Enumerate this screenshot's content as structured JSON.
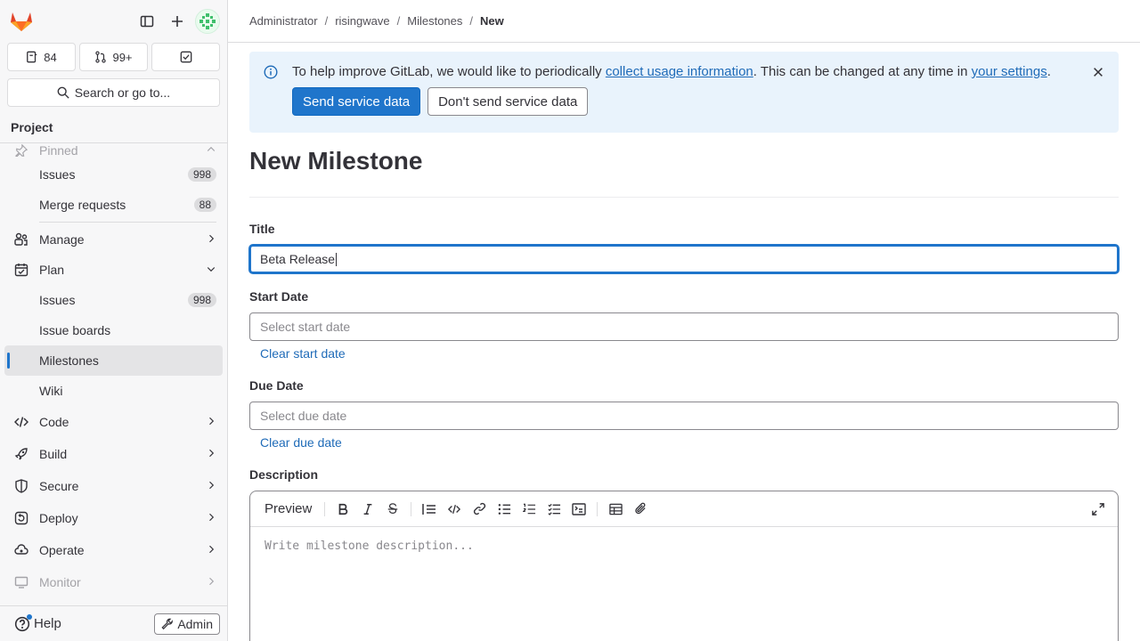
{
  "sidebar": {
    "counters": [
      {
        "label": "84",
        "icon": "issues-icon"
      },
      {
        "label": "99+",
        "icon": "merge-request-icon"
      },
      {
        "label": "",
        "icon": "todo-icon"
      }
    ],
    "search_label": "Search or go to...",
    "section_title": "Project",
    "pinned_label": "Pinned",
    "pinned_items": [
      {
        "label": "Issues",
        "badge": "998"
      },
      {
        "label": "Merge requests",
        "badge": "88"
      }
    ],
    "manage_label": "Manage",
    "plan_label": "Plan",
    "plan_items": [
      {
        "label": "Issues",
        "badge": "998"
      },
      {
        "label": "Issue boards"
      },
      {
        "label": "Milestones"
      },
      {
        "label": "Wiki"
      }
    ],
    "groups": [
      "Code",
      "Build",
      "Secure",
      "Deploy",
      "Operate",
      "Monitor"
    ],
    "help_label": "Help",
    "admin_label": "Admin"
  },
  "breadcrumb": [
    "Administrator",
    "risingwave",
    "Milestones",
    "New"
  ],
  "banner": {
    "text_before": "To help improve GitLab, we would like to periodically ",
    "link1": "collect usage information",
    "text_middle": ". This can be changed at any time in ",
    "link2": "your settings",
    "text_after": ".",
    "send_label": "Send service data",
    "dont_send_label": "Don't send service data"
  },
  "page_title": "New Milestone",
  "form": {
    "title_label": "Title",
    "title_value": "Beta Release",
    "start_label": "Start Date",
    "start_placeholder": "Select start date",
    "clear_start": "Clear start date",
    "due_label": "Due Date",
    "due_placeholder": "Select due date",
    "clear_due": "Clear due date",
    "description_label": "Description",
    "preview_label": "Preview",
    "description_placeholder": "Write milestone description..."
  },
  "colors": {
    "accent": "#1f75cb",
    "banner_bg": "#e9f3fc",
    "link": "#1f6bb8"
  }
}
